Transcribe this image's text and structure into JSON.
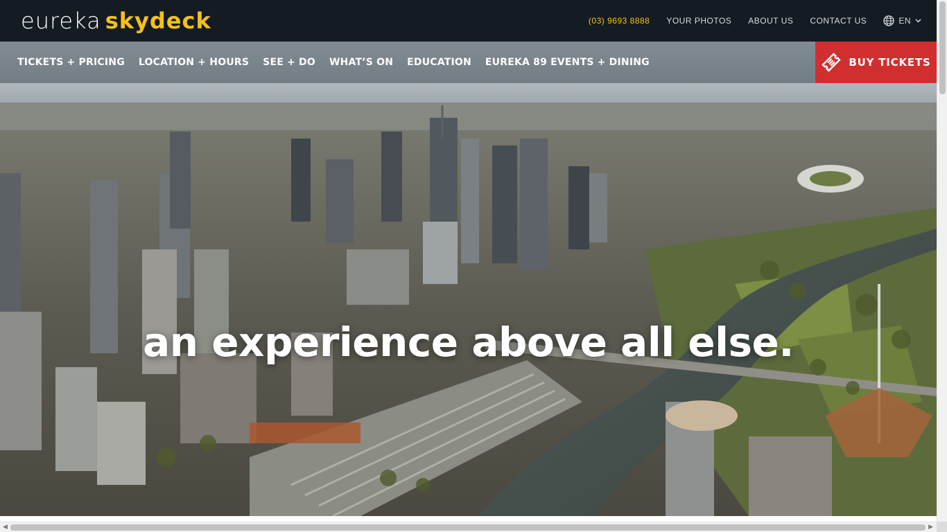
{
  "brand": {
    "logo_word1": "eureka",
    "logo_word2": "skydeck",
    "colors": {
      "accent": "#f5c11a",
      "buy": "#d12f2f",
      "topbar": "#151b22"
    }
  },
  "topbar": {
    "phone": "(03) 9693 8888",
    "links": [
      "YOUR PHOTOS",
      "ABOUT US",
      "CONTACT US"
    ],
    "language": "EN",
    "language_icon": "globe-icon"
  },
  "nav": {
    "items": [
      "TICKETS + PRICING",
      "LOCATION + HOURS",
      "SEE + DO",
      "WHAT’S ON",
      "EDUCATION",
      "EUREKA 89 EVENTS + DINING"
    ],
    "buy_label": "BUY TICKETS",
    "buy_icon": "ticket-icon"
  },
  "hero": {
    "headline": "an experience above all else.",
    "scroll_icon": "chevron-down-icon"
  }
}
